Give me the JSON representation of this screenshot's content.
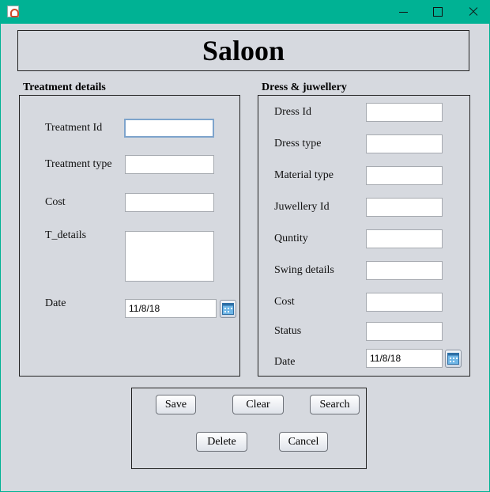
{
  "window": {
    "icon": "java-cup-icon",
    "controls": [
      "minimize-icon",
      "maximize-icon",
      "close-icon"
    ]
  },
  "banner": {
    "title": "Saloon"
  },
  "treatment": {
    "title": "Treatment details",
    "id_label": "Treatment Id",
    "id_value": "",
    "type_label": "Treatment type",
    "type_value": "",
    "cost_label": "Cost",
    "cost_value": "",
    "details_label": "T_details",
    "details_value": "",
    "date_label": "Date",
    "date_value": "11/8/18"
  },
  "dress": {
    "title": "Dress & juwellery",
    "dress_id_label": "Dress Id",
    "dress_type_label": "Dress type",
    "material_label": "Material type",
    "juwellery_label": "Juwellery Id",
    "quantity_label": "Quntity",
    "swing_label": "Swing details",
    "cost_label": "Cost",
    "status_label": "Status",
    "date_label": "Date",
    "date_value": "11/8/18"
  },
  "actions": {
    "save": "Save",
    "clear": "Clear",
    "search": "Search",
    "delete": "Delete",
    "cancel": "Cancel"
  },
  "colors": {
    "titlebar": "#00b294",
    "background": "#d6d9df"
  }
}
